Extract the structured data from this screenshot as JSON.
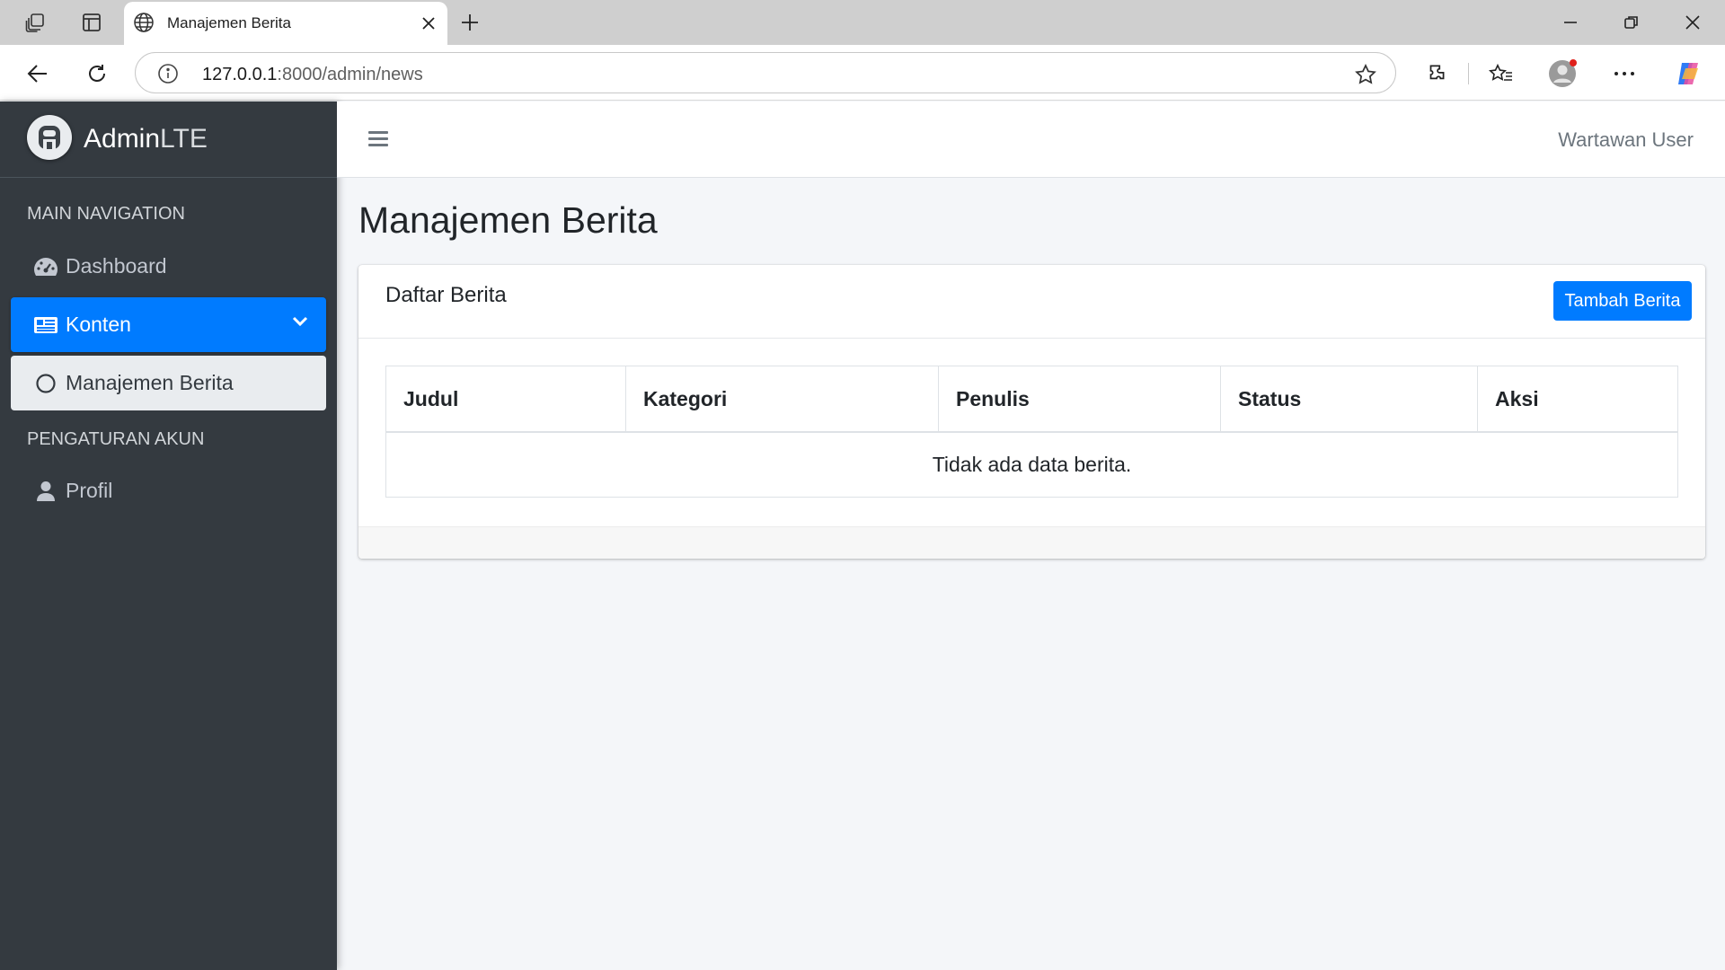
{
  "browser": {
    "tab_title": "Manajemen Berita",
    "url_host": "127.0.0.1",
    "url_path": ":8000/admin/news"
  },
  "brand": {
    "name_bold": "Admin",
    "name_light": "LTE"
  },
  "sidebar": {
    "header_main": "MAIN NAVIGATION",
    "header_account": "PENGATURAN AKUN",
    "items": [
      {
        "label": "Dashboard",
        "icon": "dashboard-gauge-icon"
      },
      {
        "label": "Konten",
        "icon": "newspaper-icon",
        "active": true
      },
      {
        "label": "Manajemen Berita",
        "icon": "circle-icon",
        "sub": true
      },
      {
        "label": "Profil",
        "icon": "user-icon"
      }
    ]
  },
  "navbar": {
    "user": "Wartawan User"
  },
  "page": {
    "title": "Manajemen Berita"
  },
  "card": {
    "title": "Daftar Berita",
    "add_button": "Tambah Berita",
    "columns": [
      "Judul",
      "Kategori",
      "Penulis",
      "Status",
      "Aksi"
    ],
    "empty_text": "Tidak ada data berita."
  },
  "colors": {
    "primary": "#007bff",
    "sidebar": "#343a40",
    "background": "#f4f6f9"
  }
}
